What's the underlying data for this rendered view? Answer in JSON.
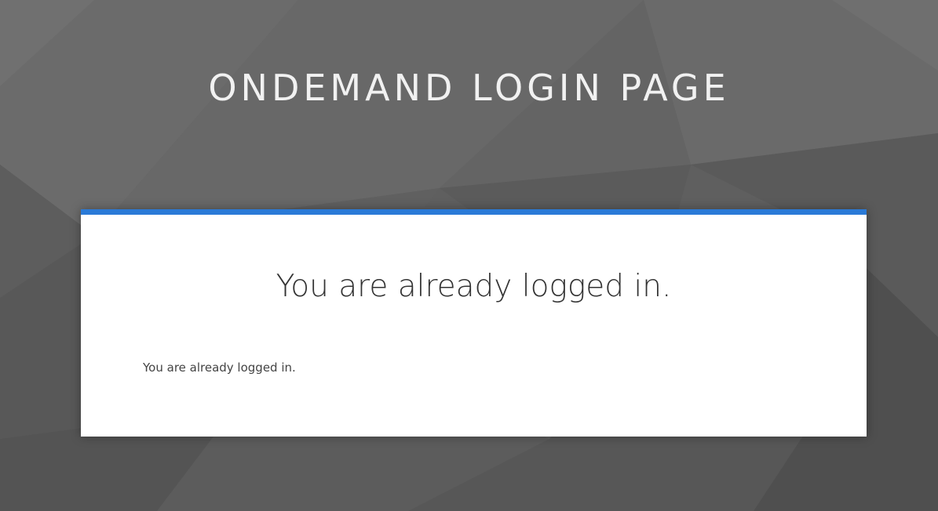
{
  "header": {
    "title": "ONDEMAND LOGIN PAGE"
  },
  "card": {
    "heading": "You are already logged in.",
    "message": "You are already logged in.",
    "accent_color": "#2a7ad7"
  }
}
